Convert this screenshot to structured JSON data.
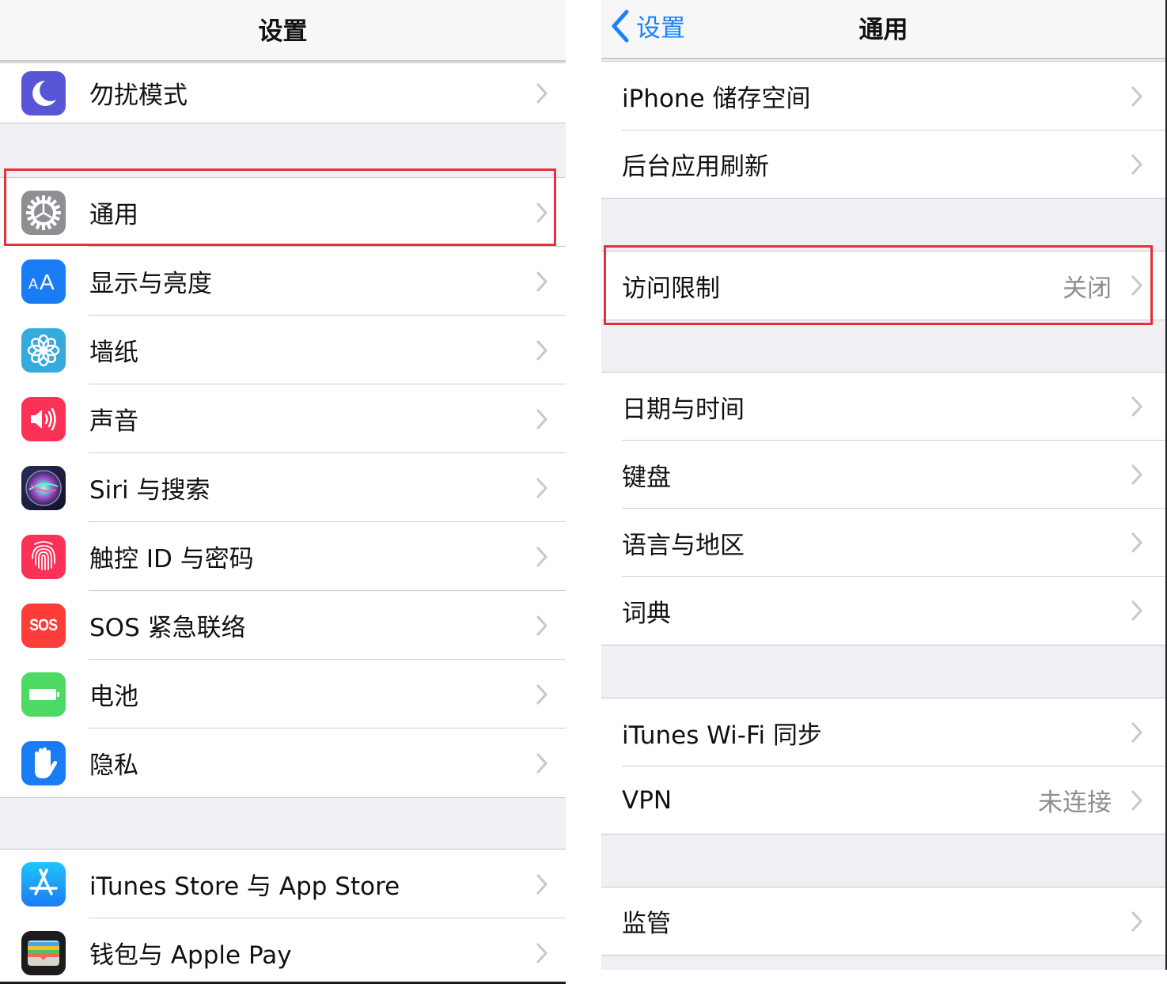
{
  "left_screen": {
    "nav_title": "设置",
    "groups": [
      {
        "items": [
          {
            "label": "勿扰模式",
            "icon": "moon-icon",
            "icon_color": "#5856d6"
          }
        ]
      },
      {
        "items": [
          {
            "label": "通用",
            "icon": "gear-icon",
            "icon_color": "#8e8e93",
            "highlighted": true
          },
          {
            "label": "显示与亮度",
            "icon": "text-size-icon",
            "icon_color": "#1a7cf5"
          },
          {
            "label": "墙纸",
            "icon": "flower-icon",
            "icon_color": "#35aadc"
          },
          {
            "label": "声音",
            "icon": "speaker-icon",
            "icon_color": "#fc3158"
          },
          {
            "label": "Siri 与搜索",
            "icon": "siri-icon",
            "icon_color": "#1c1c3a"
          },
          {
            "label": "触控 ID 与密码",
            "icon": "fingerprint-icon",
            "icon_color": "#fc3158"
          },
          {
            "label": "SOS 紧急联络",
            "icon": "sos-icon",
            "icon_color": "#fc3d39",
            "icon_text": "SOS"
          },
          {
            "label": "电池",
            "icon": "battery-icon",
            "icon_color": "#4cd964"
          },
          {
            "label": "隐私",
            "icon": "hand-icon",
            "icon_color": "#1a7cf5"
          }
        ]
      },
      {
        "items": [
          {
            "label": "iTunes Store 与 App Store",
            "icon": "app-store-icon",
            "icon_color": "#1b9bf7"
          },
          {
            "label": "钱包与 Apple Pay",
            "icon": "wallet-icon",
            "icon_color": "#1c1c1c"
          }
        ]
      }
    ]
  },
  "right_screen": {
    "back_label": "设置",
    "nav_title": "通用",
    "groups": [
      {
        "items": [
          {
            "label": "iPhone 储存空间"
          },
          {
            "label": "后台应用刷新"
          }
        ]
      },
      {
        "items": [
          {
            "label": "访问限制",
            "detail": "关闭",
            "highlighted": true
          }
        ]
      },
      {
        "items": [
          {
            "label": "日期与时间"
          },
          {
            "label": "键盘"
          },
          {
            "label": "语言与地区"
          },
          {
            "label": "词典"
          }
        ]
      },
      {
        "items": [
          {
            "label": "iTunes Wi-Fi 同步"
          },
          {
            "label": "VPN",
            "detail": "未连接"
          }
        ]
      },
      {
        "items": [
          {
            "label": "监管"
          }
        ]
      }
    ]
  },
  "colors": {
    "accent": "#1a82fb",
    "highlight_box": "#e8303a",
    "group_background": "#efeff4",
    "detail_text": "#8e8e93"
  }
}
